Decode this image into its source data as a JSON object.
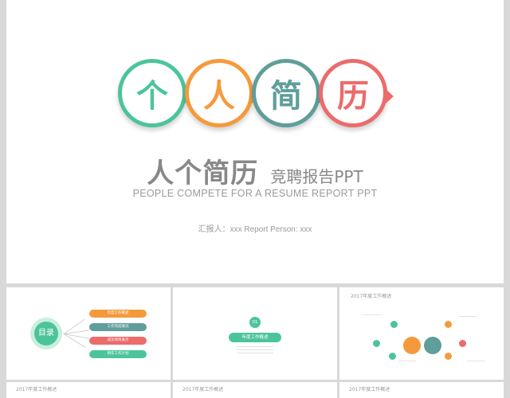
{
  "main_slide": {
    "circles": [
      {
        "char": "个",
        "color": "#4cc49a"
      },
      {
        "char": "人",
        "color": "#f59a3c"
      },
      {
        "char": "简",
        "color": "#5f9e9a"
      },
      {
        "char": "历",
        "color": "#ec6b6b"
      }
    ],
    "title_cn": "人个简历",
    "title_sub": "竞聘报告PPT",
    "title_en": "PEOPLE COMPETE FOR A RESUME REPORT PPT",
    "reporter": "汇报人：xxx   Report Person: xxx"
  },
  "thumbs": {
    "toc": {
      "badge": "目录",
      "items": [
        {
          "label": "年度工作概述",
          "color": "#f59a3c"
        },
        {
          "label": "工作完成情况",
          "color": "#5f9e9a"
        },
        {
          "label": "成功项目展示",
          "color": "#ec6b6b"
        },
        {
          "label": "明年工作计划",
          "color": "#4cc49a"
        }
      ]
    },
    "section": {
      "number": "01",
      "label": "年度工作概述"
    },
    "overview": {
      "title": "2017年度工作概述"
    }
  },
  "bottom_row": {
    "labels": [
      "2017年度工作概述",
      "2017年度工作概述",
      "2017年度工作概述"
    ]
  }
}
